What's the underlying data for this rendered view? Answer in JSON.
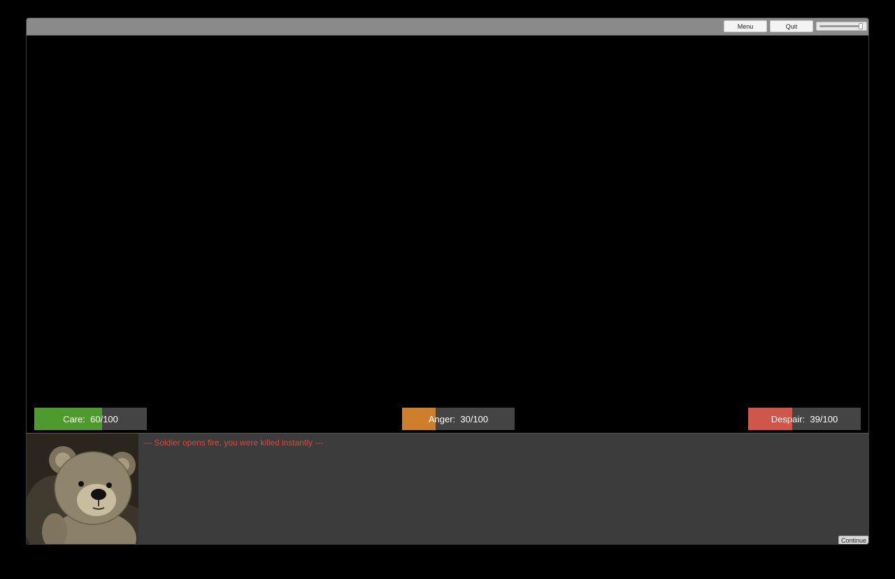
{
  "toolbar": {
    "menu_label": "Menu",
    "quit_label": "Quit",
    "volume_level": 0.92
  },
  "stats": [
    {
      "label": "Care:  60/100",
      "value": 60,
      "max": 100,
      "color": "#4e9a2e"
    },
    {
      "label": "Anger:  30/100",
      "value": 30,
      "max": 100,
      "color": "#cf7f2c"
    },
    {
      "label": "Despair:  39/100",
      "value": 39,
      "max": 100,
      "color": "#d0564b"
    }
  ],
  "dialog": {
    "message": "--- Soldier opens fire, you were killed instantly ---",
    "message_color": "#d64a3e",
    "continue_label": "Continue",
    "portrait_icon": "teddy-bear-portrait"
  }
}
